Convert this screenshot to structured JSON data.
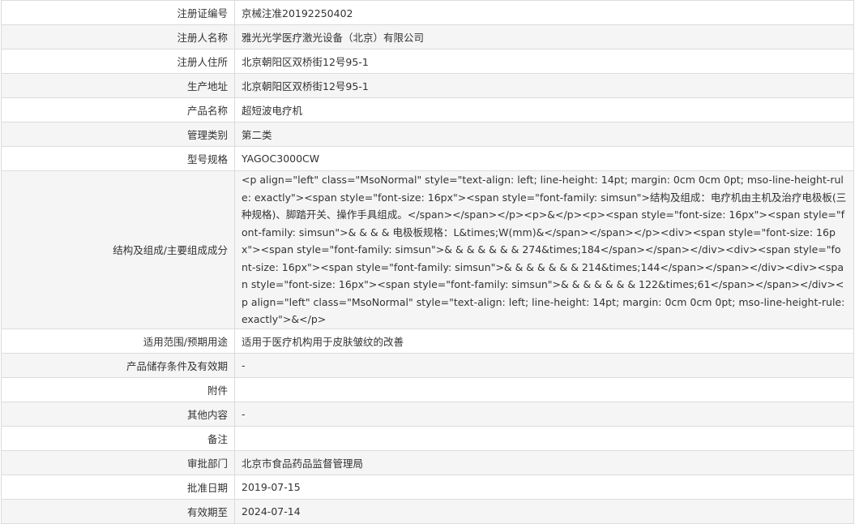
{
  "rows": [
    {
      "label": "注册证编号",
      "value": "京械注准20192250402"
    },
    {
      "label": "注册人名称",
      "value": "雅光光学医疗激光设备（北京）有限公司"
    },
    {
      "label": "注册人住所",
      "value": "北京朝阳区双桥街12号95-1"
    },
    {
      "label": "生产地址",
      "value": "北京朝阳区双桥街12号95-1"
    },
    {
      "label": "产品名称",
      "value": "超短波电疗机"
    },
    {
      "label": "管理类别",
      "value": "第二类"
    },
    {
      "label": "型号规格",
      "value": "YAGOC3000CW"
    },
    {
      "label": "结构及组成/主要组成成分",
      "value": "<p align=\"left\" class=\"MsoNormal\" style=\"text-align: left; line-height: 14pt; margin: 0cm 0cm 0pt; mso-line-height-rule: exactly\"><span style=\"font-size: 16px\"><span style=\"font-family: simsun\">结构及组成：电疗机由主机及治疗电极板(三种规格)、脚踏开关、操作手具组成。</span></span></p><p>&</p><p><span style=\"font-size: 16px\"><span style=\"font-family: simsun\">& & & & 电极板规格：L&times;W(mm)&</span></span></p><div><span style=\"font-size: 16px\"><span style=\"font-family: simsun\">& & & & & & & 274&times;184</span></span></div><div><span style=\"font-size: 16px\"><span style=\"font-family: simsun\">& & & & & & & 214&times;144</span></span></div><div><span style=\"font-size: 16px\"><span style=\"font-family: simsun\">& & & & & & & 122&times;61</span></span></div><p align=\"left\" class=\"MsoNormal\" style=\"text-align: left; line-height: 14pt; margin: 0cm 0cm 0pt; mso-line-height-rule: exactly\">&</p>"
    },
    {
      "label": "适用范围/预期用途",
      "value": "适用于医疗机构用于皮肤皱纹的改善"
    },
    {
      "label": "产品储存条件及有效期",
      "value": "-"
    },
    {
      "label": "附件",
      "value": ""
    },
    {
      "label": "其他内容",
      "value": "-"
    },
    {
      "label": "备注",
      "value": ""
    },
    {
      "label": "审批部门",
      "value": "北京市食品药品监督管理局"
    },
    {
      "label": "批准日期",
      "value": "2019-07-15"
    },
    {
      "label": "有效期至",
      "value": "2024-07-14"
    }
  ]
}
